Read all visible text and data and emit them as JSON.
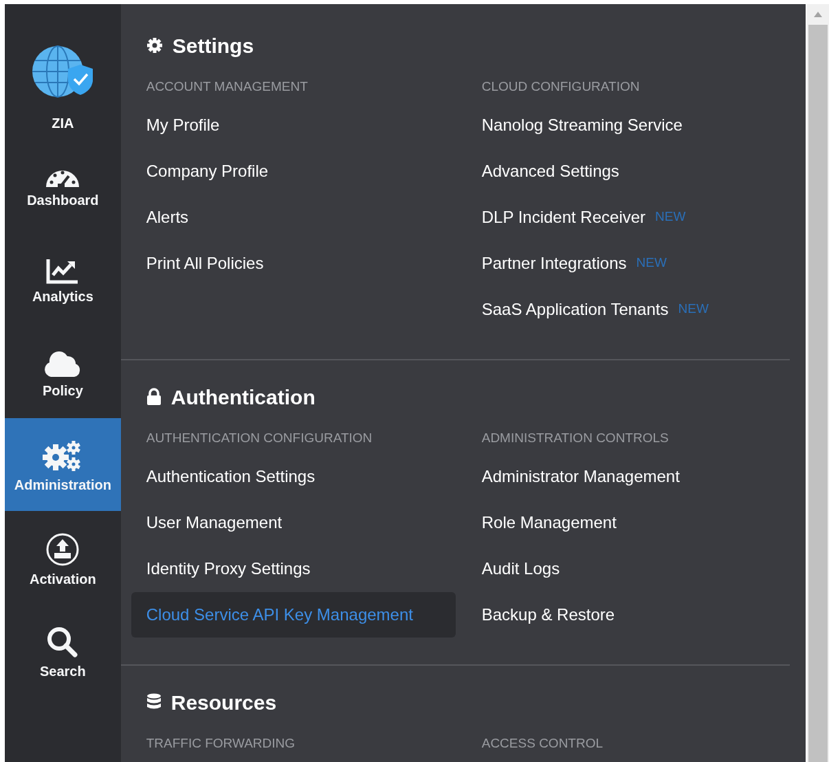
{
  "sidebar": {
    "logo": {
      "label": "ZIA"
    },
    "items": [
      {
        "kind": "dashboard",
        "label": "Dashboard",
        "selected": false
      },
      {
        "kind": "analytics",
        "label": "Analytics",
        "selected": false
      },
      {
        "kind": "policy",
        "label": "Policy",
        "selected": false
      },
      {
        "kind": "administration",
        "label": "Administration",
        "selected": true
      },
      {
        "kind": "activation",
        "label": "Activation",
        "selected": false
      },
      {
        "kind": "search",
        "label": "Search",
        "selected": false
      }
    ]
  },
  "sections": [
    {
      "kind": "gear",
      "title": "Settings",
      "columns": [
        {
          "heading": "ACCOUNT MANAGEMENT",
          "items": [
            {
              "label": "My Profile",
              "selected": false
            },
            {
              "label": "Company Profile",
              "selected": false
            },
            {
              "label": "Alerts",
              "selected": false
            },
            {
              "label": "Print All Policies",
              "selected": false
            }
          ]
        },
        {
          "heading": "CLOUD CONFIGURATION",
          "items": [
            {
              "label": "Nanolog Streaming Service",
              "selected": false
            },
            {
              "label": "Advanced Settings",
              "selected": false
            },
            {
              "label": "DLP Incident Receiver",
              "badge": "NEW",
              "selected": false
            },
            {
              "label": "Partner Integrations",
              "badge": "NEW",
              "selected": false
            },
            {
              "label": "SaaS Application Tenants",
              "badge": "NEW",
              "selected": false
            }
          ]
        }
      ]
    },
    {
      "kind": "lock",
      "title": "Authentication",
      "columns": [
        {
          "heading": "AUTHENTICATION CONFIGURATION",
          "items": [
            {
              "label": "Authentication Settings",
              "selected": false
            },
            {
              "label": "User Management",
              "selected": false
            },
            {
              "label": "Identity Proxy Settings",
              "selected": false
            },
            {
              "label": "Cloud Service API Key Management",
              "selected": true
            }
          ]
        },
        {
          "heading": "ADMINISTRATION CONTROLS",
          "items": [
            {
              "label": "Administrator Management",
              "selected": false
            },
            {
              "label": "Role Management",
              "selected": false
            },
            {
              "label": "Audit Logs",
              "selected": false
            },
            {
              "label": "Backup & Restore",
              "selected": false
            }
          ]
        }
      ]
    },
    {
      "kind": "database",
      "title": "Resources",
      "columns": [
        {
          "heading": "TRAFFIC FORWARDING"
        },
        {
          "heading": "ACCESS CONTROL"
        }
      ]
    }
  ]
}
